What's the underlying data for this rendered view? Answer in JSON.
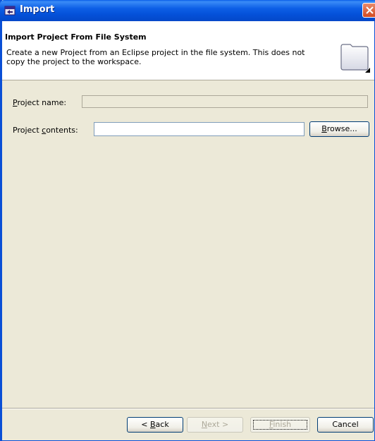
{
  "window": {
    "title": "Import"
  },
  "header": {
    "title": "Import Project From File System",
    "description": "Create a new Project from an Eclipse project in the file system. This does not copy the project to the workspace."
  },
  "form": {
    "project_name": {
      "label_mnemonic": "P",
      "label_rest": "roject name:",
      "value": ""
    },
    "project_contents": {
      "label_pre": "Project ",
      "label_mnemonic": "c",
      "label_rest": "ontents:",
      "value": ""
    },
    "browse_button": {
      "mnemonic": "B",
      "label_rest": "rowse..."
    }
  },
  "buttons": {
    "back": {
      "prefix": "< ",
      "mnemonic": "B",
      "rest": "ack"
    },
    "next": {
      "mnemonic": "N",
      "rest": "ext >"
    },
    "finish": {
      "mnemonic": "F",
      "rest": "inish"
    },
    "cancel": {
      "label": "Cancel"
    }
  },
  "colors": {
    "titlebar": "#0a5ee8",
    "dialog_bg": "#ece9d8",
    "close_button": "#d34a22"
  }
}
